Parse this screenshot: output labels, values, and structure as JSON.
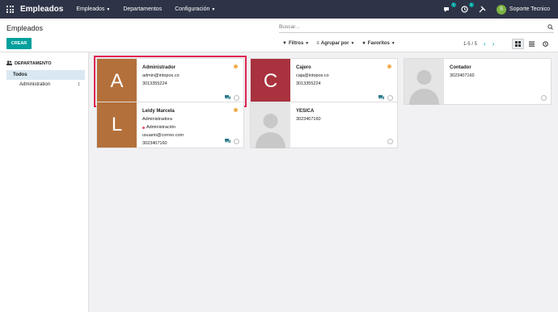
{
  "navbar": {
    "brand": "Empleados",
    "menu": [
      "Empleados",
      "Departamentos",
      "Configuración"
    ],
    "chat_count": "1",
    "activity_count": "1",
    "user_initial": "S",
    "user_name": "Soporte Tecnico"
  },
  "control": {
    "breadcrumb": "Empleados",
    "create_label": "CREAR",
    "search_placeholder": "Buscar...",
    "filters_label": "Filtros",
    "group_label": "Agrupar por",
    "favorites_label": "Favoritos",
    "pager": "1-5 / 5"
  },
  "side": {
    "title": "DEPARTAMENTO",
    "items": [
      {
        "label": "Todos",
        "count": ""
      },
      {
        "label": "Administration",
        "count": "1"
      }
    ]
  },
  "employees": [
    {
      "initial": "A",
      "color": "#b4703a",
      "name": "Administrador",
      "line1": "admin@intopos.co",
      "line2": "3013355224",
      "line3": "",
      "line4": "",
      "highlighted": true
    },
    {
      "initial": "C",
      "color": "#a8323e",
      "name": "Cajero",
      "line1": "caja@intopos.co",
      "line2": "3013355224",
      "line3": "",
      "line4": ""
    },
    {
      "initial": "",
      "color": "",
      "name": "Contador",
      "line1": "3023407160",
      "line2": "",
      "line3": "",
      "line4": ""
    },
    {
      "initial": "L",
      "color": "#b4703a",
      "name": "Leidy Marcela",
      "line1": "Administradora",
      "line2": "Administración",
      "line3": "usuario@correo.com",
      "line4": "3023407160"
    },
    {
      "initial": "",
      "color": "",
      "name": "YESICA",
      "line1": "3023407160",
      "line2": "",
      "line3": "",
      "line4": ""
    }
  ]
}
